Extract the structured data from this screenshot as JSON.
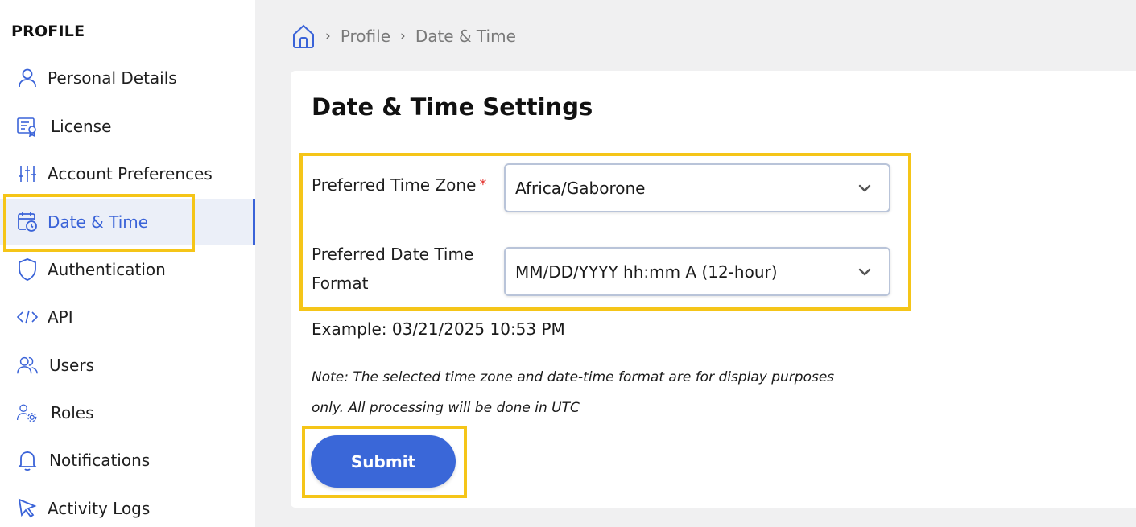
{
  "sidebar": {
    "title": "PROFILE",
    "items": [
      {
        "label": "Personal Details",
        "icon": "user-icon"
      },
      {
        "label": "License",
        "icon": "license-icon"
      },
      {
        "label": "Account Preferences",
        "icon": "sliders-icon"
      },
      {
        "label": "Date & Time",
        "icon": "calendar-clock-icon",
        "active": true
      },
      {
        "label": "Authentication",
        "icon": "shield-icon"
      },
      {
        "label": "API",
        "icon": "code-icon"
      },
      {
        "label": "Users",
        "icon": "users-icon"
      },
      {
        "label": "Roles",
        "icon": "user-gear-icon"
      },
      {
        "label": "Notifications",
        "icon": "bell-icon"
      },
      {
        "label": "Activity Logs",
        "icon": "cursor-icon"
      }
    ]
  },
  "breadcrumb": {
    "items": [
      "Profile",
      "Date & Time"
    ]
  },
  "main": {
    "title": "Date & Time Settings",
    "timezone": {
      "label": "Preferred Time Zone",
      "required_mark": "*",
      "value": "Africa/Gaborone"
    },
    "datetime_format": {
      "label_line1": "Preferred Date Time",
      "label_line2": "Format",
      "value": "MM/DD/YYYY hh:mm A (12-hour)"
    },
    "example": "Example: 03/21/2025 10:53 PM",
    "note_line1": "Note: The selected time zone and date-time format are for display purposes",
    "note_line2": "only. All processing will be done in UTC",
    "submit_label": "Submit"
  },
  "colors": {
    "accent": "#3a63d8",
    "highlight": "#f5c518",
    "required": "#e53935"
  }
}
